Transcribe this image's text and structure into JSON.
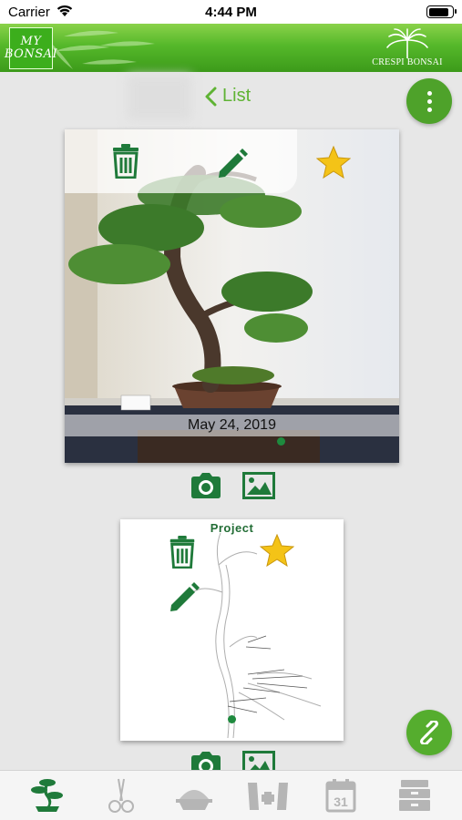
{
  "status_bar": {
    "carrier": "Carrier",
    "time": "4:44 PM",
    "battery_level": 0.9
  },
  "header": {
    "logo_lines": [
      "MY",
      "BONSAI"
    ],
    "brand": "CRESPI BONSAI"
  },
  "nav": {
    "back_label": "List"
  },
  "photo_card": {
    "date": "May 24, 2019",
    "favorite": true
  },
  "project_card": {
    "title": "Project",
    "favorite": true
  },
  "tabs": [
    {
      "icon": "bonsai-tree-icon",
      "active": true
    },
    {
      "icon": "scissors-icon",
      "active": false
    },
    {
      "icon": "soil-pot-icon",
      "active": false
    },
    {
      "icon": "fertilizer-icon",
      "active": false
    },
    {
      "icon": "calendar-icon",
      "active": false,
      "label": "31"
    },
    {
      "icon": "toolbox-icon",
      "active": false
    }
  ],
  "colors": {
    "accent_green": "#4ea22a",
    "icon_green": "#1f7a3a",
    "star_yellow": "#f4c317",
    "tab_inactive": "#b5b5b5"
  }
}
